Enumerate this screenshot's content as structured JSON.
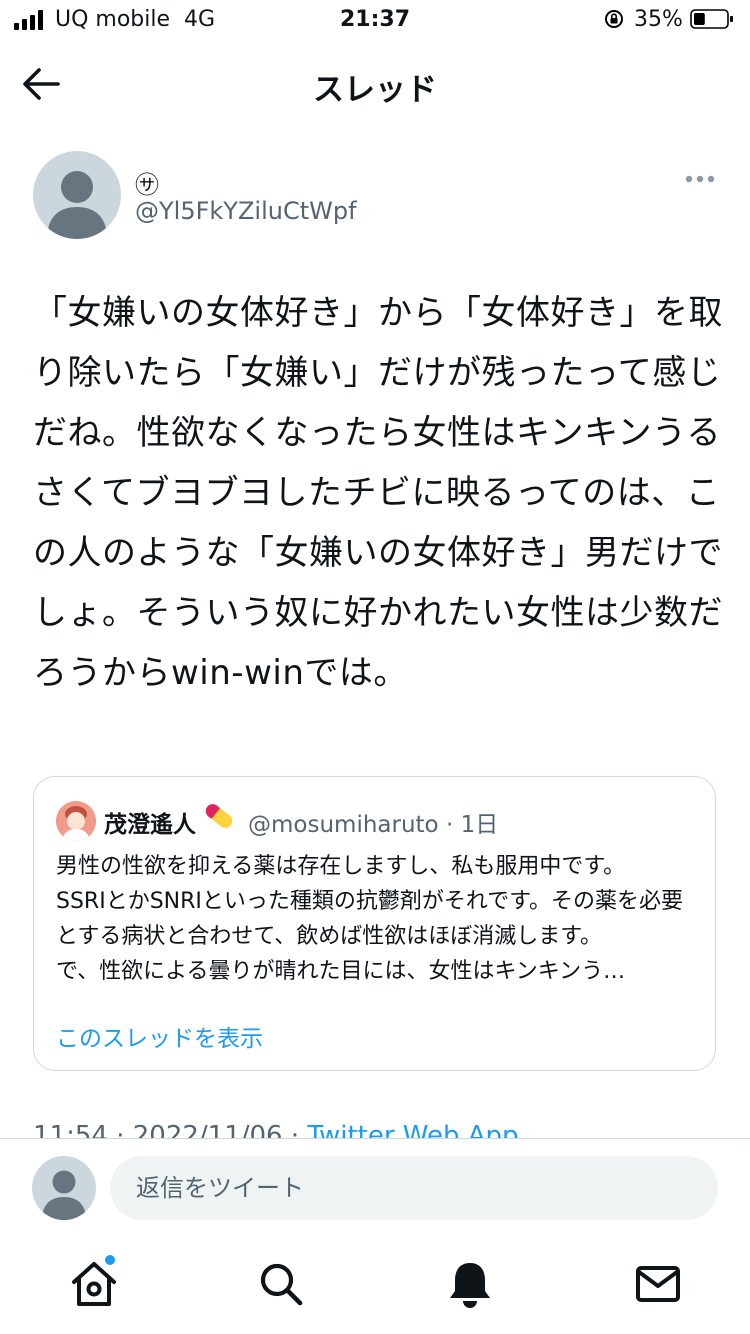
{
  "status_bar": {
    "carrier": "UQ mobile",
    "network": "4G",
    "time": "21:37",
    "battery": "35%",
    "battery_level": 0.35,
    "icons": [
      "signal-icon",
      "orientation-lock-icon",
      "battery-icon"
    ]
  },
  "header": {
    "title": "スレッド",
    "back_icon": "back-arrow-icon"
  },
  "tweet": {
    "display_name": "㋚",
    "handle": "@Yl5FkYZiluCtWpf",
    "text": "「女嫌いの女体好き」から「女体好き」を取り除いたら「女嫌い」だけが残ったって感じだね。性欲なくなったら女性はキンキンうるさくてブヨブヨしたチビに映るってのは、この人のような「女嫌いの女体好き」男だけでしょ。そういう奴に好かれたい女性は少数だろうからwin-winでは。",
    "meta_time": "11:54",
    "meta_date": "2022/11/06",
    "meta_app": "Twitter Web App",
    "more_icon": "more-horizontal-icon"
  },
  "quote": {
    "name": "茂澄遙人",
    "emoji_icon": "pill-icon",
    "handle": "@mosumiharuto",
    "age": "1日",
    "text": "男性の性欲を抑える薬は存在しますし、私も服用中です。\nSSRIとかSNRIといった種類の抗鬱剤がそれです。その薬を必要とする病状と合わせて、飲めば性欲はほぼ消滅します。\nで、性欲による曇りが晴れた目には、女性はキンキンう…",
    "show_thread": "このスレッドを表示"
  },
  "reply": {
    "placeholder": "返信をツイート"
  },
  "nav": {
    "items": [
      "home-icon",
      "search-icon",
      "notifications-icon",
      "messages-icon"
    ],
    "home_has_badge": true
  },
  "colors": {
    "accent": "#1d9bf0",
    "text": "#0f1419",
    "muted": "#536471",
    "border": "#cfd9de",
    "input_bg": "#eff3f4"
  }
}
